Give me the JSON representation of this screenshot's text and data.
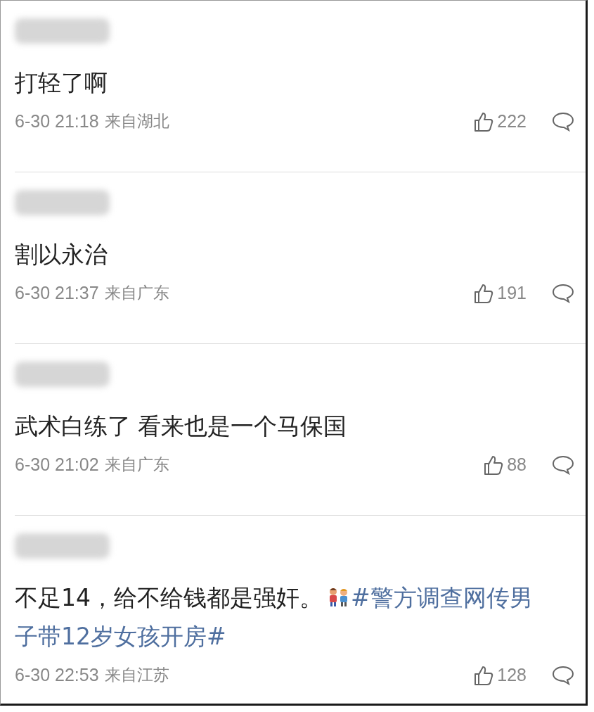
{
  "comments": [
    {
      "text": "打轻了啊",
      "time": "6-30 21:18",
      "location": "来自湖北",
      "likes": "222"
    },
    {
      "text": "割以永治",
      "time": "6-30 21:37",
      "location": "来自广东",
      "likes": "191"
    },
    {
      "text": "武术白练了 看来也是一个马保国",
      "time": "6-30 21:02",
      "location": "来自广东",
      "likes": "88"
    },
    {
      "text": "不足14，给不给钱都是强奸。",
      "hashtag": "#警方调查网传男子带12岁女孩开房#",
      "time": "6-30 22:53",
      "location": "来自江苏",
      "likes": "128"
    }
  ]
}
